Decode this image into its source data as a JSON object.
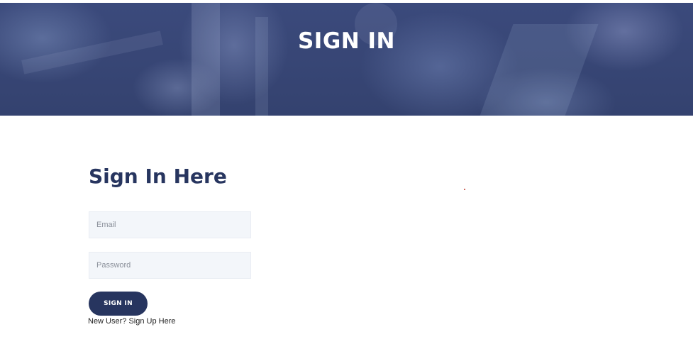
{
  "hero": {
    "title": "SIGN IN"
  },
  "form": {
    "heading": "Sign In Here",
    "email_placeholder": "Email",
    "password_placeholder": "Password",
    "submit_label": "SIGN IN",
    "signup_link": "New User? Sign Up Here"
  },
  "colors": {
    "brand": "#27355f",
    "input_bg": "#f3f6fa"
  }
}
